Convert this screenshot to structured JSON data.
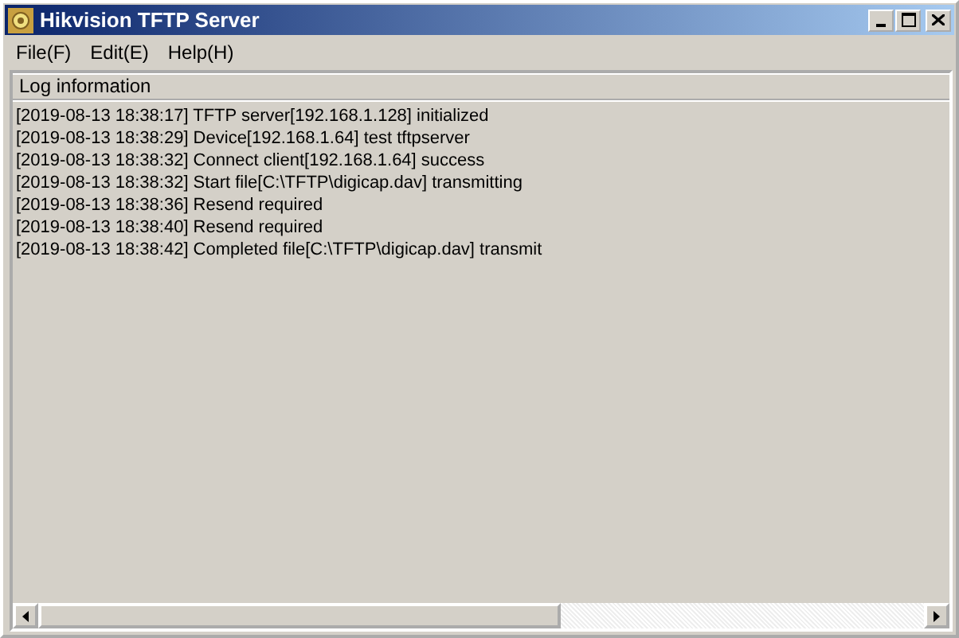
{
  "window": {
    "title": "Hikvision TFTP Server"
  },
  "menu": [
    "File(F)",
    "Edit(E)",
    "Help(H)"
  ],
  "log": {
    "header": "Log information",
    "lines": [
      "[2019-08-13 18:38:17] TFTP server[192.168.1.128] initialized",
      "[2019-08-13 18:38:29] Device[192.168.1.64] test tftpserver",
      "[2019-08-13 18:38:32] Connect client[192.168.1.64] success",
      "[2019-08-13 18:38:32] Start file[C:\\TFTP\\digicap.dav] transmitting",
      "[2019-08-13 18:38:36] Resend required",
      "[2019-08-13 18:38:40] Resend required",
      "[2019-08-13 18:38:42] Completed file[C:\\TFTP\\digicap.dav] transmit"
    ]
  }
}
